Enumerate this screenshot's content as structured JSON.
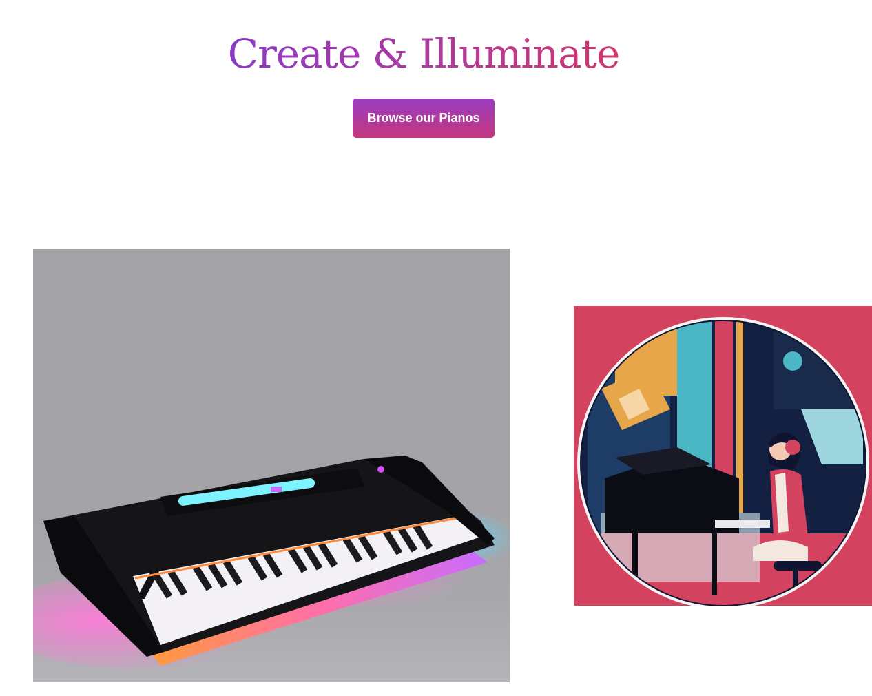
{
  "hero": {
    "title": "Create & Illuminate",
    "title_gradient": [
      "#8b3bc8",
      "#d0386e"
    ]
  },
  "cta": {
    "label": "Browse our Pianos",
    "gradient": [
      "#9a3cc0",
      "#c4387e"
    ]
  },
  "gallery": {
    "images": [
      {
        "name": "illuminated-keyboard-image",
        "background": "#a4a4a8"
      },
      {
        "name": "pianist-illustration-image",
        "background": "#d34360"
      }
    ]
  }
}
